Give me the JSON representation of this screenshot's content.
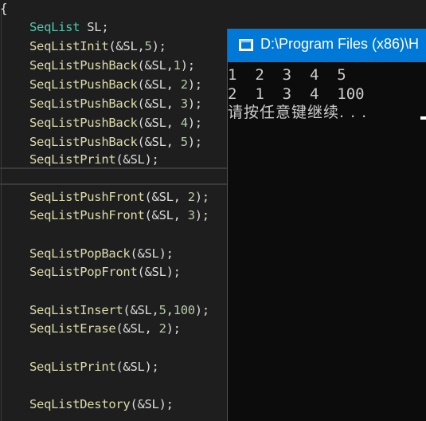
{
  "editor": {
    "open_brace": "{",
    "lines": [
      {
        "type_kw": "SeqList",
        "rest": " SL;"
      },
      {
        "fn": "SeqListInit",
        "open": "(&SL,",
        "num": "5",
        "close": ");"
      },
      {
        "fn": "SeqListPushBack",
        "open": "(&SL,",
        "num": "1",
        "close": ");"
      },
      {
        "fn": "SeqListPushBack",
        "open": "(&SL, ",
        "num": "2",
        "close": ");"
      },
      {
        "fn": "SeqListPushBack",
        "open": "(&SL, ",
        "num": "3",
        "close": ");"
      },
      {
        "fn": "SeqListPushBack",
        "open": "(&SL, ",
        "num": "4",
        "close": ");"
      },
      {
        "fn": "SeqListPushBack",
        "open": "(&SL, ",
        "num": "5",
        "close": ");"
      },
      {
        "fn": "SeqListPrint",
        "open": "(&SL);"
      },
      {
        "fn": "SeqListPushFront",
        "open": "(&SL, ",
        "num": "2",
        "close": ");"
      },
      {
        "fn": "SeqListPushFront",
        "open": "(&SL, ",
        "num": "3",
        "close": ");"
      },
      {
        "fn": "SeqListPopBack",
        "open": "(&SL);"
      },
      {
        "fn": "SeqListPopFront",
        "open": "(&SL);"
      },
      {
        "fn": "SeqListInsert",
        "open": "(&SL,",
        "num": "5",
        "sep": ",",
        "num2": "100",
        "close": ");"
      },
      {
        "fn": "SeqListErase",
        "open": "(&SL, ",
        "num": "2",
        "close": ");"
      },
      {
        "fn": "SeqListPrint",
        "open": "(&SL);"
      },
      {
        "fn": "SeqListDestory",
        "open": "(&SL);"
      }
    ]
  },
  "console": {
    "title": "D:\\Program Files (x86)\\H",
    "output": [
      "1  2  3  4  5",
      "2  1  3  4  100",
      "请按任意键继续. . ."
    ]
  },
  "colors": {
    "editor_bg": "#1e1e1e",
    "type_color": "#4ec9b0",
    "function_color": "#dcdcaa",
    "number_color": "#b5cea8",
    "console_title_bg": "#0078d7",
    "console_bg": "#0c0c0c"
  }
}
